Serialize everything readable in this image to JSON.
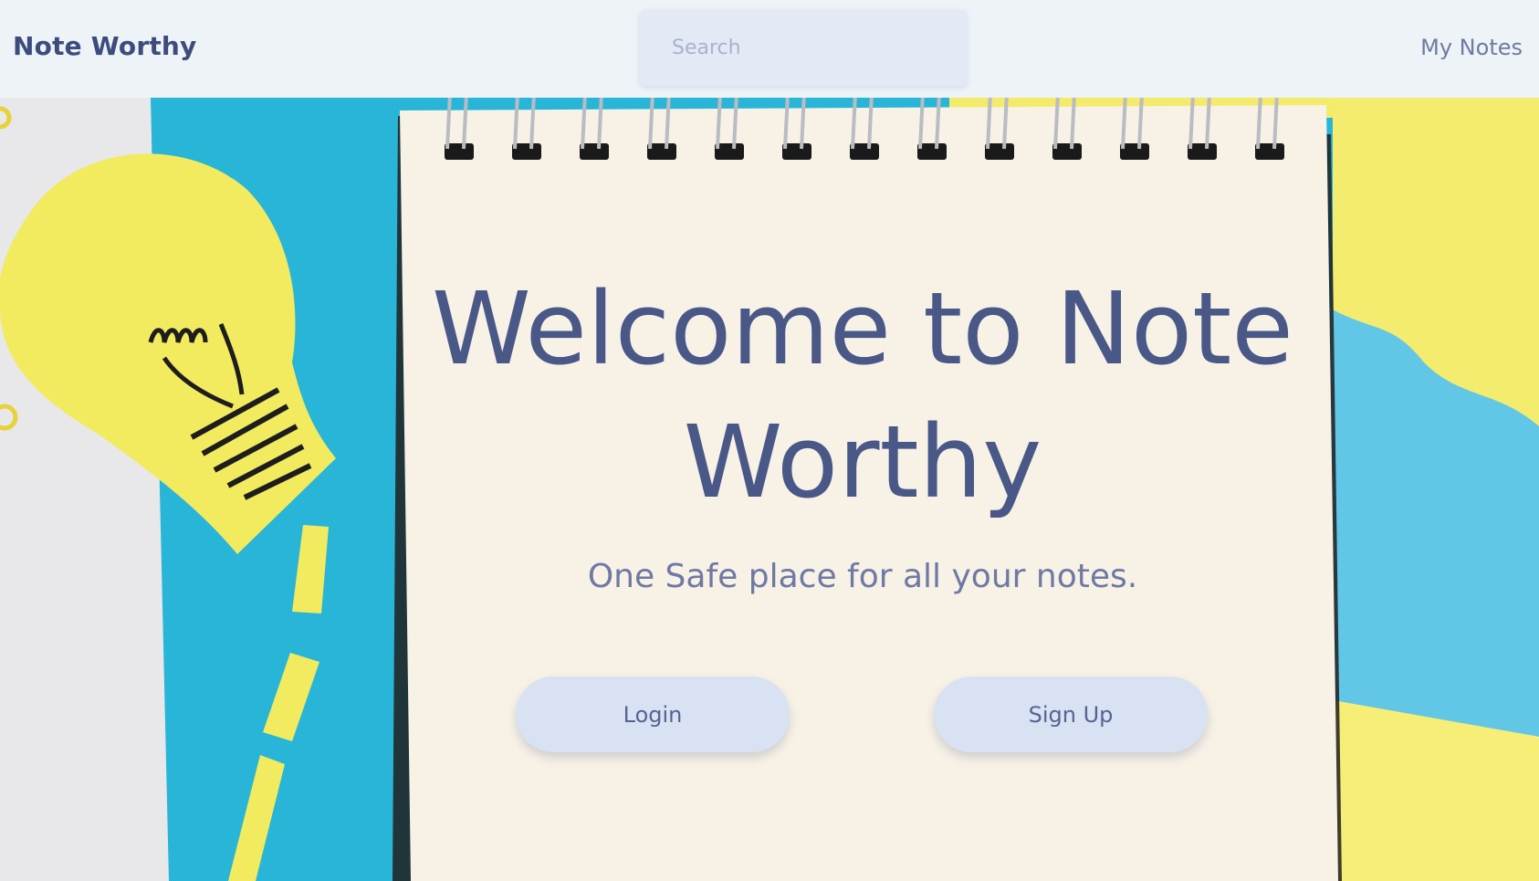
{
  "navbar": {
    "brand": "Note Worthy",
    "search_placeholder": "Search",
    "my_notes_label": "My Notes"
  },
  "hero": {
    "heading_line1": "Welcome to Note",
    "heading_line2": "Worthy",
    "tagline": "One Safe place for all your notes.",
    "login_label": "Login",
    "signup_label": "Sign Up"
  },
  "colors": {
    "navbar_bg": "#eef3f8",
    "brand": "#3c4c7c",
    "heading": "#4a5888",
    "button_bg": "#d9e2f2",
    "paper": "#f7f1e6",
    "blue_paper": "#29b5d8",
    "yellow_paper": "#f4ec6e"
  }
}
